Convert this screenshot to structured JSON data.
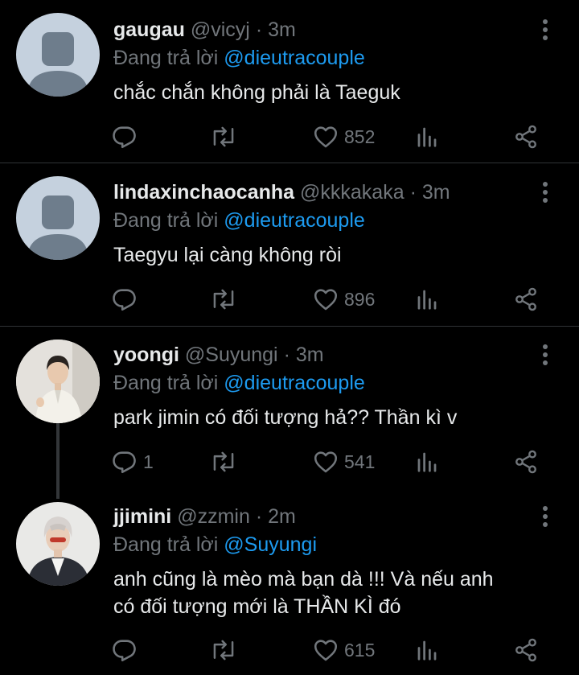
{
  "ui": {
    "reply_prefix": "Đang trả lời",
    "separator": "·"
  },
  "colors": {
    "background": "#000000",
    "name": "#e7e9ea",
    "muted": "#71767b",
    "mention": "#1d9bf0",
    "divider": "#2f3336"
  },
  "tweets": [
    {
      "name": "gaugau",
      "handle": "@vicyj",
      "time": "3m",
      "reply_to": "@dieutracouple",
      "text_lines": [
        "chắc chắn không phải là Taeguk"
      ],
      "replies": "",
      "likes": "852",
      "avatar": "default-avatar"
    },
    {
      "name": "lindaxinchaocanha",
      "handle": "@kkkakaka",
      "time": "3m",
      "reply_to": "@dieutracouple",
      "text_lines": [
        "Taegyu lại càng không ròi"
      ],
      "replies": "",
      "likes": "896",
      "avatar": "default-avatar"
    },
    {
      "name": "yoongi",
      "handle": "@Suyungi",
      "time": "3m",
      "reply_to": "@dieutracouple",
      "text_lines": [
        "park jimin có đối tượng hả?? Thần kì v"
      ],
      "replies": "1",
      "likes": "541",
      "avatar": "photo-avatar"
    },
    {
      "name": "jjimini",
      "handle": "@zzmin",
      "time": "2m",
      "reply_to": "@Suyungi",
      "text_lines": [
        "anh cũng là mèo mà bạn dà !!! Và nếu anh",
        "có đối tượng mới là THẦN KÌ đó"
      ],
      "replies": "",
      "likes": "615",
      "avatar": "photo-avatar"
    }
  ]
}
